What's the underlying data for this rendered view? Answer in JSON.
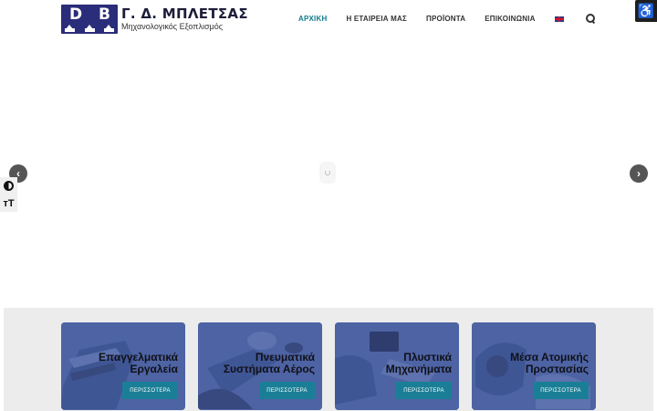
{
  "header": {
    "logo_letters": [
      "D",
      "B"
    ],
    "logo_title": "Γ. Δ. ΜΠΛΕΤΣΑΣ",
    "logo_subtitle": "Μηχανολογικός Εξοπλισμός"
  },
  "nav": {
    "items": [
      {
        "label": "ΑΡΧΙΚΗ",
        "active": true
      },
      {
        "label": "Η ΕΤΑΙΡΕΙΑ ΜΑΣ",
        "active": false
      },
      {
        "label": "ΠΡΟΪΟΝΤΑ",
        "active": false
      },
      {
        "label": "ΕΠΙΚΟΙΝΩΝΙΑ",
        "active": false
      }
    ],
    "language_icon": "uk-flag-icon",
    "search_icon": "search-icon",
    "accent_color": "#137a8c"
  },
  "accessibility": {
    "icon": "wheelchair-icon",
    "glyph": "♿",
    "contrast_icon": "contrast-icon",
    "font_size_glyph": "ᴛT"
  },
  "slider": {
    "prev_glyph": "‹",
    "next_glyph": "›"
  },
  "categories": [
    {
      "title_line1": "Επαγγελματικά",
      "title_line2": "Εργαλεία",
      "button": "ΠΕΡΙΣΣΟΤΕΡΑ"
    },
    {
      "title_line1": "Πνευματικά",
      "title_line2": "Συστήματα Αέρος",
      "button": "ΠΕΡΙΣΣΟΤΕΡΑ"
    },
    {
      "title_line1": "Πλυστικά",
      "title_line2": "Μηχανήματα",
      "button": "ΠΕΡΙΣΣΟΤΕΡΑ"
    },
    {
      "title_line1": "Μέσα Ατομικής",
      "title_line2": "Προστασίας",
      "button": "ΠΕΡΙΣΣΟΤΕΡΑ"
    }
  ],
  "colors": {
    "card_bg": "#4d63a3",
    "button_bg": "#1a7f96",
    "logo_bg": "#2a2d7a"
  }
}
